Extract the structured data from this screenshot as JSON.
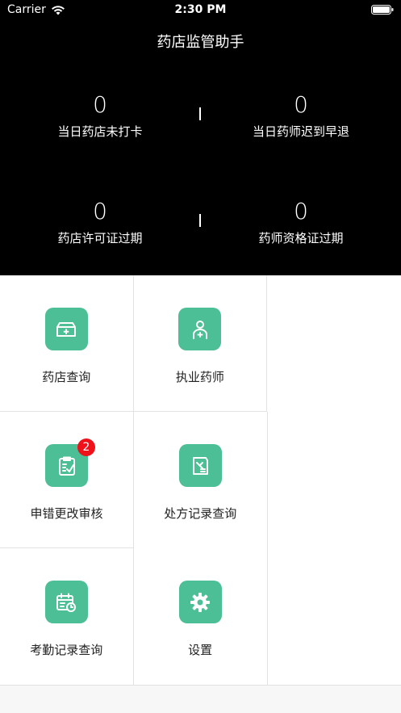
{
  "status_bar": {
    "carrier": "Carrier",
    "time": "2:30 PM"
  },
  "header": {
    "title": "药店监管助手"
  },
  "stats": [
    {
      "value": "0",
      "label": "当日药店未打卡"
    },
    {
      "value": "0",
      "label": "当日药师迟到早退"
    },
    {
      "value": "0",
      "label": "药店许可证过期"
    },
    {
      "value": "0",
      "label": "药师资格证过期"
    }
  ],
  "menu": [
    {
      "label": "药店查询",
      "icon": "pharmacy-box-icon"
    },
    {
      "label": "执业药师",
      "icon": "pharmacist-icon"
    },
    {
      "label": "申错更改审核",
      "icon": "clipboard-check-icon",
      "badge": "2"
    },
    {
      "label": "处方记录查询",
      "icon": "prescription-icon"
    },
    {
      "label": "考勤记录查询",
      "icon": "attendance-calendar-icon"
    },
    {
      "label": "设置",
      "icon": "gear-icon"
    }
  ],
  "colors": {
    "accent": "#4dbf96",
    "badge": "#f0121a",
    "header_bg": "#000000"
  }
}
